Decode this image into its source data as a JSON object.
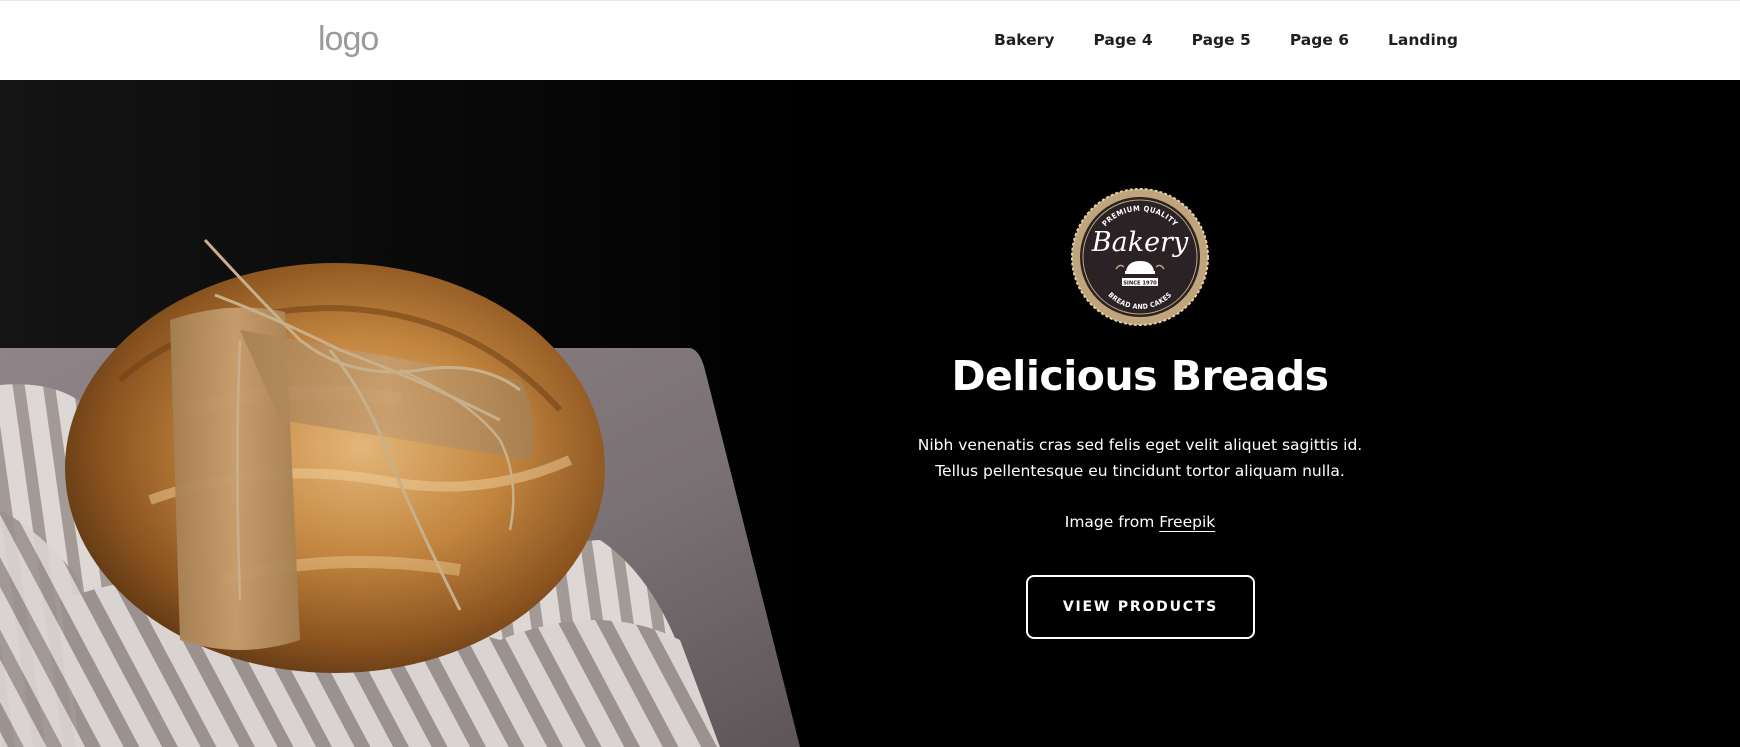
{
  "header": {
    "logo": "logo",
    "nav": [
      "Bakery",
      "Page 4",
      "Page 5",
      "Page 6",
      "Landing"
    ]
  },
  "hero": {
    "badge": {
      "top_text": "PREMIUM QUALITY",
      "script_text": "Bakery",
      "ribbon_text": "SINCE 1970",
      "bottom_text": "BREAD AND CAKES"
    },
    "title": "Delicious Breads",
    "description": "Nibh venenatis cras sed felis eget velit aliquet sagittis id. Tellus pellentesque eu tincidunt tortor aliquam nulla.",
    "credit_prefix": "Image from",
    "credit_link": "Freepik",
    "cta": "VIEW PRODUCTS"
  },
  "colors": {
    "background": "#000000",
    "header_bg": "#ffffff",
    "nav_text": "#1f1f1f",
    "logo_gray": "#9a9a9a",
    "badge_gold": "#bfa47c"
  }
}
